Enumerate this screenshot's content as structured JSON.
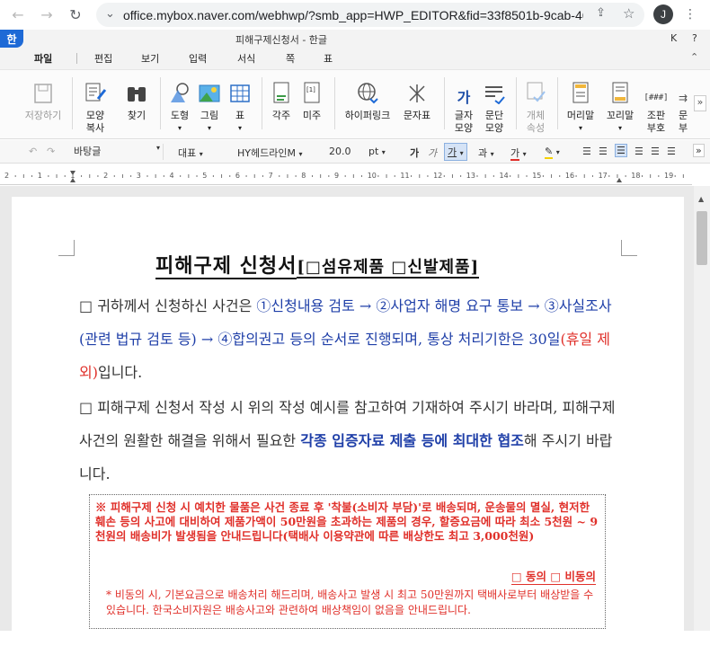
{
  "browser": {
    "url": "office.mybox.naver.com/webhwp/?smb_app=HWP_EDITOR&fid=33f8501b-9cab-462...",
    "avatar_letter": "J"
  },
  "app": {
    "logo": "한",
    "title": "피해구제신청서 - 한글",
    "right_k": "K",
    "right_help": "?"
  },
  "menu": [
    "파일",
    "편집",
    "보기",
    "입력",
    "서식",
    "쪽",
    "표"
  ],
  "ribbon": {
    "save": "저장하기",
    "copy_shape_1": "모양",
    "copy_shape_2": "복사",
    "find": "찾기",
    "shape": "도형",
    "picture": "그림",
    "table": "표",
    "footnote": "각주",
    "endnote": "미주",
    "hyperlink": "하이퍼링크",
    "char_table": "문자표",
    "char_shape_1": "글자",
    "char_shape_2": "모양",
    "para_shape_1": "문단",
    "para_shape_2": "모양",
    "obj_prop_1": "개체",
    "obj_prop_2": "속성",
    "header": "머리말",
    "footer": "꼬리말",
    "bookmark_1": "조판",
    "bookmark_2": "부호",
    "more_1": "문",
    "more_2": "부",
    "table_icon_text": "[1]",
    "hash_icon_text": "[###]"
  },
  "format": {
    "style": "바탕글",
    "lang": "대표",
    "font": "HY헤드라인M",
    "size": "20.0",
    "unit": "pt",
    "bold": "가",
    "italic": "가",
    "underline": "가",
    "strike": "과",
    "color": "가"
  },
  "ruler": [
    "2",
    "1",
    "1",
    "2",
    "3",
    "4",
    "5",
    "6",
    "7",
    "8",
    "9",
    "10",
    "11",
    "12",
    "13",
    "14",
    "15",
    "16",
    "17",
    "18",
    "19"
  ],
  "doc": {
    "title_main": "피해구제 신청서",
    "title_sub": "[□섬유제품 □신발제품]",
    "p1_a": "□ 귀하께서 신청하신 사건은 ",
    "p1_b": "①신청내용 검토 → ②사업자 해명 요구 통보 → ③사실조사(관련 법규 검토 등) → ④합의권고 등의 순서로 진행되며, 통상 처리기한은 30일",
    "p1_c": "(휴일 제외)",
    "p1_d": "입니다.",
    "p2_a": "□ 피해구제 신청서 작성 시 위의 작성 예시를 참고하여 기재하여 주시기 바라며, 피해구제 사건의 원활한 해결을 위해서 필요한 ",
    "p2_b": "각종 입증자료 제출 등에 최대한 협조",
    "p2_c": "해 주시기 바랍니다.",
    "notice_main": "※ 피해구제 신청 시 예치한 물품은 사건 종료 후 '착불(소비자 부담)'로 배송되며, 운송물의 멸실, 현저한 훼손 등의 사고에 대비하여 제품가액이 50만원을 초과하는 제품의 경우, 할증요금에 따라 최소 5천원 ~ 9천원의 배송비가 발생됨을 안내드립니다(택배사 이용약관에 따른 배상한도 최고 3,000천원)",
    "consent": "□ 동의 □ 비동의",
    "notice_sub": "* 비동의 시, 기본요금으로 배송처리 해드리며, 배송사고 발생 시 최고 50만원까지 택배사로부터 배상받을 수 있습니다. 한국소비자원은 배송사고와 관련하여 배상책임이 없음을 안내드립니다."
  }
}
